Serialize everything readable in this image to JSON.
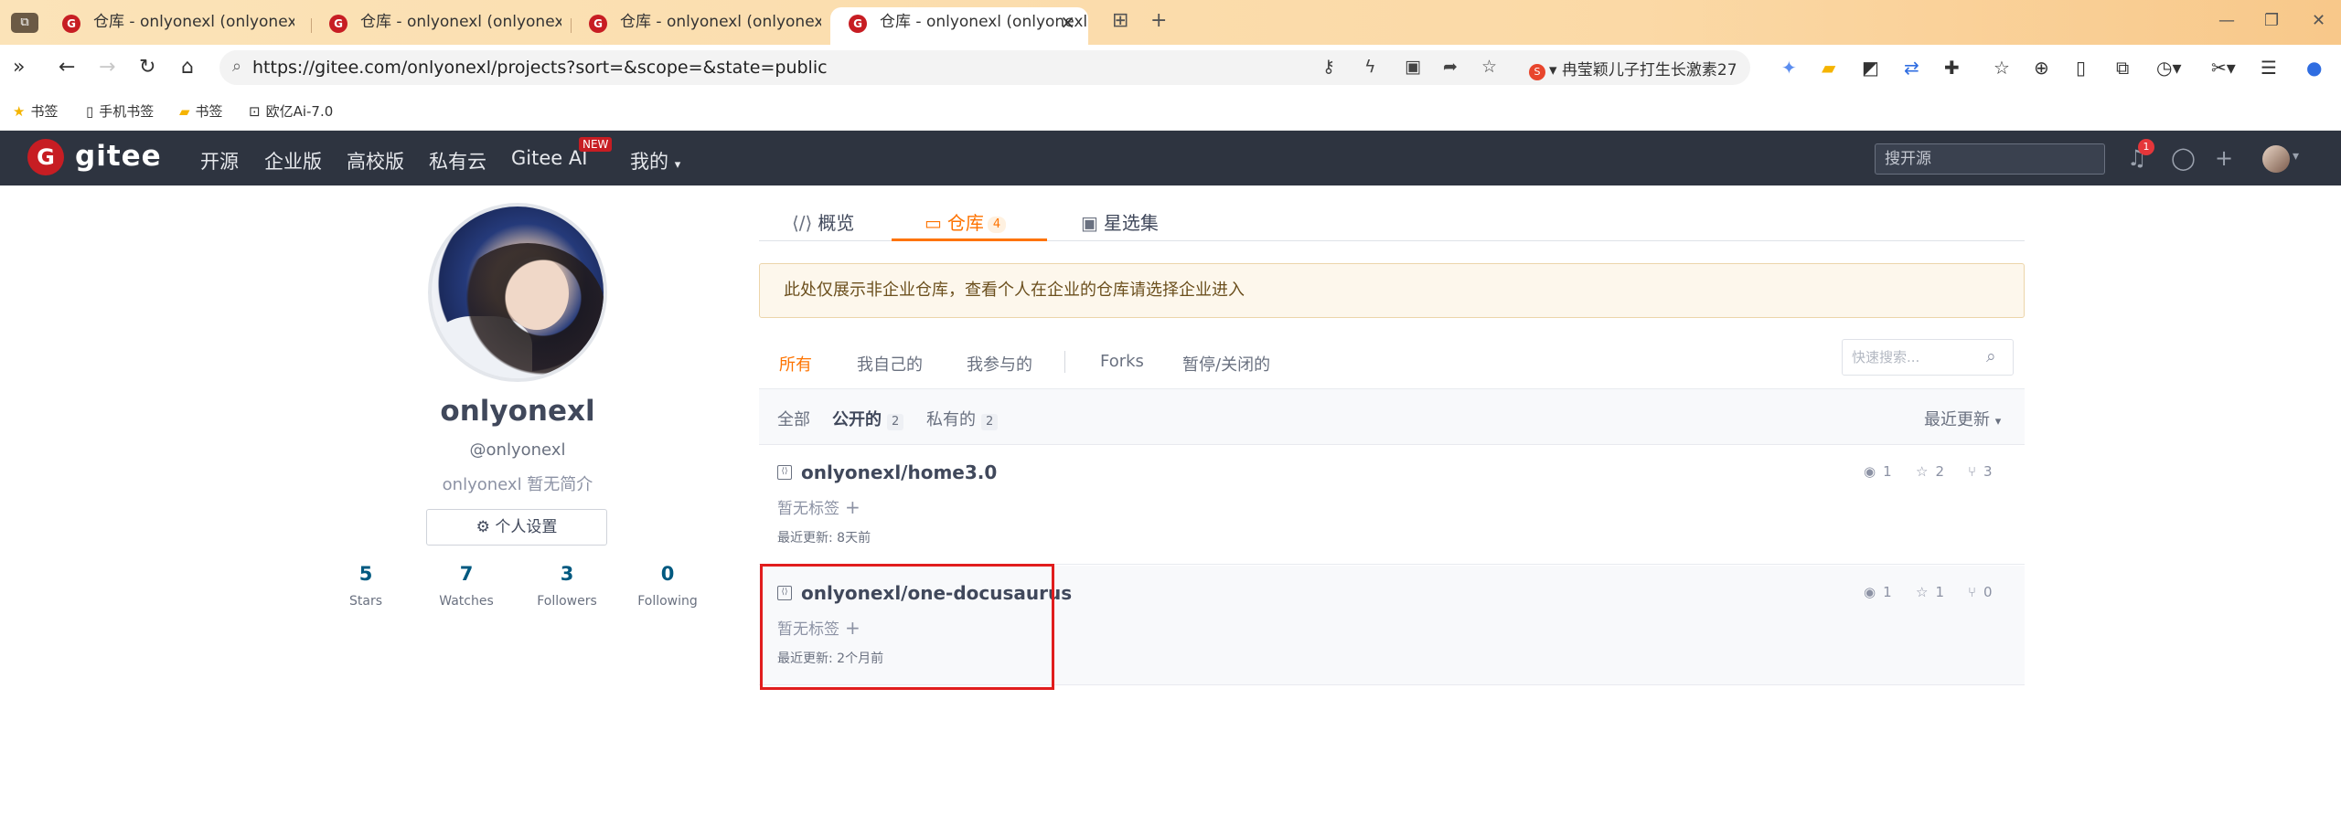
{
  "browser": {
    "tabs": [
      {
        "title": "仓库 - onlyonexl (onlyonexl) - Gi"
      },
      {
        "title": "仓库 - onlyonexl (onlyonexl) - "
      },
      {
        "title": "仓库 - onlyonexl (onlyonexl) - "
      },
      {
        "title": "仓库 - onlyonexl (onlyonexl)"
      }
    ],
    "active_tab_index": 3,
    "url": "https://gitee.com/onlyonexl/projects?sort=&scope=&state=public",
    "search_suggestion": "冉莹颖儿子打生长激素27",
    "bookmarks": [
      {
        "label": "书签",
        "icon": "star-icon"
      },
      {
        "label": "手机书签",
        "icon": "phone-icon"
      },
      {
        "label": "书签",
        "icon": "folder-icon"
      },
      {
        "label": "欧亿Ai-7.0",
        "icon": "robot-icon"
      }
    ]
  },
  "gitee_header": {
    "logo_text": "gitee",
    "nav": [
      "开源",
      "企业版",
      "高校版",
      "私有云",
      "Gitee AI",
      "我的"
    ],
    "new_badge": "NEW",
    "search_placeholder": "搜开源",
    "notification_count": "1"
  },
  "profile": {
    "name": "onlyonexl",
    "login": "@onlyonexl",
    "bio": "onlyonexl 暂无简介",
    "settings_label": "个人设置",
    "stats": [
      {
        "value": "5",
        "label": "Stars"
      },
      {
        "value": "7",
        "label": "Watches"
      },
      {
        "value": "3",
        "label": "Followers"
      },
      {
        "value": "0",
        "label": "Following"
      }
    ]
  },
  "profile_tabs": [
    {
      "label": "概览",
      "icon": "code-icon"
    },
    {
      "label": "仓库",
      "icon": "repo-folder-icon",
      "count": "4"
    },
    {
      "label": "星选集",
      "icon": "collection-icon"
    }
  ],
  "notice": "此处仅展示非企业仓库，查看个人在企业的仓库请选择企业进入",
  "filter_tabs": [
    "所有",
    "我自己的",
    "我参与的",
    "Forks",
    "暂停/关闭的"
  ],
  "quick_search_placeholder": "快速搜索...",
  "scope_tabs": [
    {
      "label": "全部"
    },
    {
      "label": "公开的",
      "count": "2"
    },
    {
      "label": "私有的",
      "count": "2"
    }
  ],
  "sort_label": "最近更新",
  "repos": [
    {
      "name": "onlyonexl/home3.0",
      "tags": "暂无标签",
      "updated": "最近更新: 8天前",
      "watches": "1",
      "stars": "2",
      "forks": "3"
    },
    {
      "name": "onlyonexl/one-docusaurus",
      "tags": "暂无标签",
      "updated": "最近更新: 2个月前",
      "watches": "1",
      "stars": "1",
      "forks": "0"
    }
  ],
  "colors": {
    "accent": "#fe7300",
    "header_bg": "#2e3440",
    "brand_red": "#c71d23",
    "highlight": "#e11d1d"
  }
}
